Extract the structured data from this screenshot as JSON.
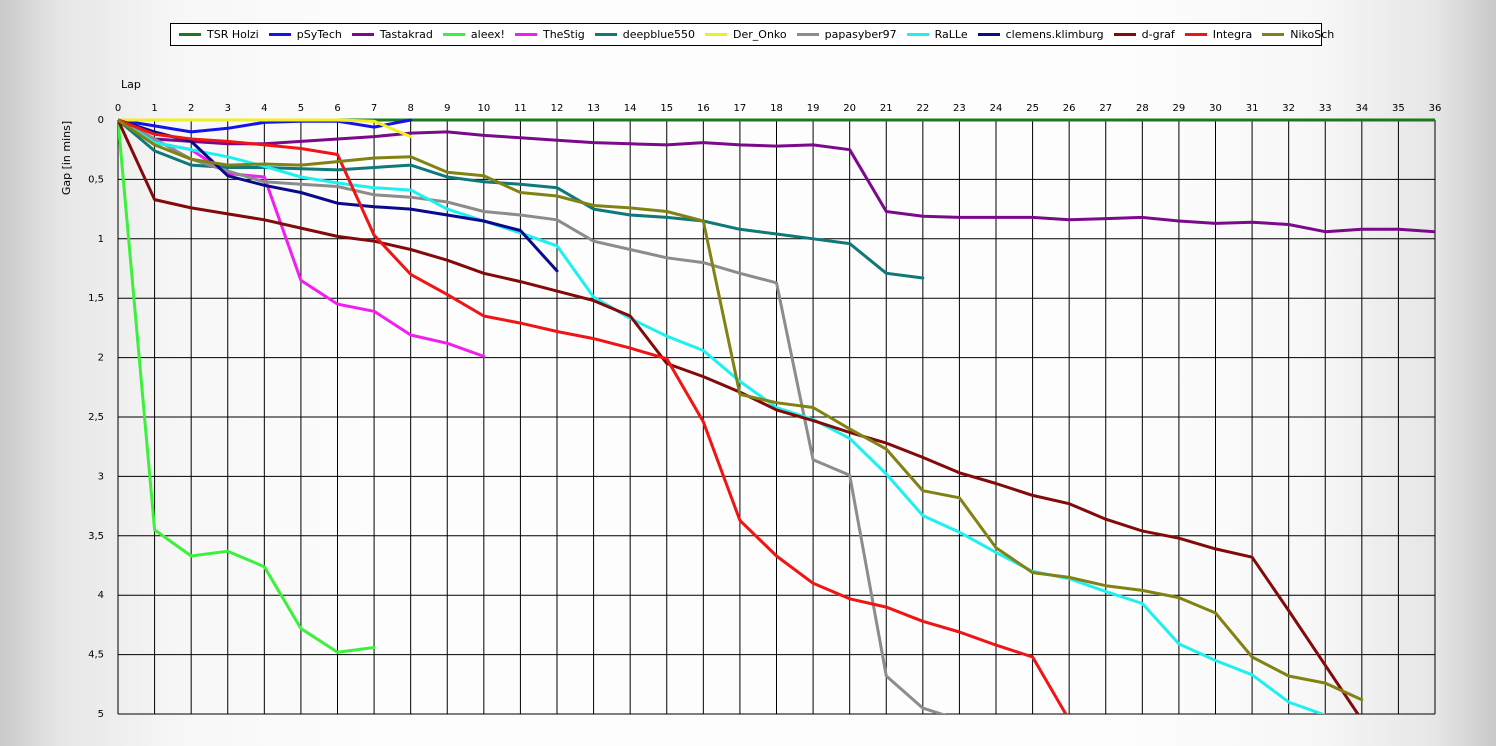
{
  "chart_data": {
    "type": "line",
    "title": "",
    "xlabel": "Lap",
    "ylabel": "Gap [in mins]",
    "xlim": [
      0,
      36
    ],
    "ylim": [
      0,
      5
    ],
    "y_inverted": true,
    "grid": true,
    "legend_position": "top",
    "x_ticks": [
      "0",
      "1",
      "2",
      "3",
      "4",
      "5",
      "6",
      "7",
      "8",
      "9",
      "10",
      "11",
      "12",
      "13",
      "14",
      "15",
      "16",
      "17",
      "18",
      "19",
      "20",
      "21",
      "22",
      "23",
      "24",
      "25",
      "26",
      "27",
      "28",
      "29",
      "30",
      "31",
      "32",
      "33",
      "34",
      "35",
      "36"
    ],
    "y_ticks": [
      {
        "value": 0,
        "label": "0"
      },
      {
        "value": 0.5,
        "label": "0,5"
      },
      {
        "value": 1,
        "label": "1"
      },
      {
        "value": 1.5,
        "label": "1,5"
      },
      {
        "value": 2,
        "label": "2"
      },
      {
        "value": 2.5,
        "label": "2,5"
      },
      {
        "value": 3,
        "label": "3"
      },
      {
        "value": 3.5,
        "label": "3,5"
      },
      {
        "value": 4,
        "label": "4"
      },
      {
        "value": 4.5,
        "label": "4,5"
      },
      {
        "value": 5,
        "label": "5"
      }
    ],
    "series": [
      {
        "name": "TSR Holzi",
        "color": "#1a7a1a",
        "x": [
          0,
          1,
          2,
          3,
          4,
          5,
          6,
          7,
          8,
          9,
          10,
          11,
          12,
          13,
          14,
          15,
          16,
          17,
          18,
          19,
          20,
          21,
          22,
          23,
          24,
          25,
          26,
          27,
          28,
          29,
          30,
          31,
          32,
          33,
          34,
          35,
          36
        ],
        "values": [
          0,
          0,
          0,
          0,
          0,
          0,
          0,
          0,
          0,
          0,
          0,
          0,
          0,
          0,
          0,
          0,
          0,
          0,
          0,
          0,
          0,
          0,
          0,
          0,
          0,
          0,
          0,
          0,
          0,
          0,
          0,
          0,
          0,
          0,
          0,
          0,
          0
        ]
      },
      {
        "name": "pSyTech",
        "color": "#1414e8",
        "x": [
          0,
          1,
          2,
          3,
          4,
          5,
          6,
          7,
          8
        ],
        "values": [
          0,
          0.05,
          0.1,
          0.07,
          0.02,
          0.01,
          0.01,
          0.06,
          0
        ]
      },
      {
        "name": "Tastakrad",
        "color": "#7a0a8a",
        "x": [
          0,
          1,
          2,
          3,
          4,
          5,
          6,
          7,
          8,
          9,
          10,
          11,
          12,
          13,
          14,
          15,
          16,
          17,
          18,
          19,
          20,
          21,
          22,
          23,
          24,
          25,
          26,
          27,
          28,
          29,
          30,
          31,
          32,
          33,
          34,
          35,
          36
        ],
        "values": [
          0,
          0.16,
          0.18,
          0.2,
          0.2,
          0.18,
          0.16,
          0.14,
          0.11,
          0.1,
          0.13,
          0.15,
          0.17,
          0.19,
          0.2,
          0.21,
          0.19,
          0.21,
          0.22,
          0.21,
          0.25,
          0.77,
          0.81,
          0.82,
          0.82,
          0.82,
          0.84,
          0.83,
          0.82,
          0.85,
          0.87,
          0.86,
          0.88,
          0.94,
          0.92,
          0.92,
          0.94
        ]
      },
      {
        "name": "aleex!",
        "color": "#3cf03c",
        "x": [
          0,
          1,
          2,
          3,
          4,
          5,
          6,
          7
        ],
        "values": [
          0,
          3.45,
          3.67,
          3.63,
          3.76,
          4.28,
          4.48,
          4.44
        ]
      },
      {
        "name": "TheStig",
        "color": "#f01ef0",
        "x": [
          0,
          1,
          2,
          3,
          4,
          5,
          6,
          7,
          8,
          9,
          10
        ],
        "values": [
          0,
          0.19,
          0.25,
          0.45,
          0.48,
          1.35,
          1.55,
          1.61,
          1.81,
          1.88,
          1.99
        ]
      },
      {
        "name": "deepblue550",
        "color": "#0f7878",
        "x": [
          0,
          1,
          2,
          3,
          4,
          5,
          6,
          7,
          8,
          9,
          10,
          11,
          12,
          13,
          14,
          15,
          16,
          17,
          18,
          19,
          20,
          21,
          22
        ],
        "values": [
          0,
          0.26,
          0.38,
          0.4,
          0.4,
          0.41,
          0.42,
          0.4,
          0.38,
          0.48,
          0.52,
          0.54,
          0.57,
          0.75,
          0.8,
          0.82,
          0.85,
          0.92,
          0.96,
          1.0,
          1.04,
          1.29,
          1.33
        ]
      },
      {
        "name": "Der_Onko",
        "color": "#f0f01e",
        "x": [
          0,
          1,
          2,
          3,
          4,
          5,
          6,
          7,
          8
        ],
        "values": [
          0,
          0,
          0,
          0,
          0,
          0,
          0,
          0.01,
          0.14
        ]
      },
      {
        "name": "papasyber97",
        "color": "#8c8c8c",
        "x": [
          0,
          1,
          2,
          3,
          4,
          5,
          6,
          7,
          8,
          9,
          10,
          11,
          12,
          13,
          14,
          15,
          16,
          17,
          18,
          19,
          20,
          21,
          22,
          23
        ],
        "values": [
          0,
          0.16,
          0.33,
          0.43,
          0.52,
          0.54,
          0.56,
          0.63,
          0.65,
          0.69,
          0.77,
          0.8,
          0.84,
          1.02,
          1.09,
          1.16,
          1.2,
          1.29,
          1.37,
          2.86,
          2.99,
          4.68,
          4.95,
          5.05
        ]
      },
      {
        "name": "RaLLe",
        "color": "#1ef0f0",
        "x": [
          0,
          1,
          2,
          3,
          4,
          5,
          6,
          7,
          8,
          9,
          10,
          11,
          12,
          13,
          14,
          15,
          16,
          17,
          18,
          19,
          20,
          21,
          22,
          23,
          24,
          25,
          26,
          27,
          28,
          29,
          30,
          31,
          32,
          33
        ],
        "values": [
          0,
          0.19,
          0.25,
          0.31,
          0.39,
          0.48,
          0.53,
          0.57,
          0.59,
          0.75,
          0.85,
          0.95,
          1.06,
          1.49,
          1.67,
          1.82,
          1.94,
          2.2,
          2.42,
          2.52,
          2.68,
          2.98,
          3.33,
          3.47,
          3.64,
          3.8,
          3.86,
          3.97,
          4.07,
          4.41,
          4.55,
          4.67,
          4.9,
          5.01
        ]
      },
      {
        "name": "clemens.klimburg",
        "color": "#0a0a8c",
        "x": [
          0,
          1,
          2,
          3,
          4,
          5,
          6,
          7,
          8,
          9,
          10,
          11,
          12
        ],
        "values": [
          0,
          0.1,
          0.18,
          0.47,
          0.55,
          0.61,
          0.7,
          0.73,
          0.75,
          0.8,
          0.85,
          0.93,
          1.27
        ]
      },
      {
        "name": "d-graf",
        "color": "#820a0a",
        "x": [
          0,
          1,
          2,
          3,
          4,
          5,
          6,
          7,
          8,
          9,
          10,
          11,
          12,
          13,
          14,
          15,
          16,
          17,
          18,
          19,
          20,
          21,
          22,
          23,
          24,
          25,
          26,
          27,
          28,
          29,
          30,
          31,
          32,
          33,
          34
        ],
        "values": [
          0,
          0.67,
          0.74,
          0.79,
          0.84,
          0.91,
          0.98,
          1.02,
          1.09,
          1.18,
          1.29,
          1.36,
          1.44,
          1.52,
          1.65,
          2.05,
          2.16,
          2.29,
          2.44,
          2.53,
          2.63,
          2.72,
          2.84,
          2.97,
          3.06,
          3.16,
          3.23,
          3.36,
          3.46,
          3.52,
          3.61,
          3.68,
          4.13,
          4.59,
          5.05
        ]
      },
      {
        "name": "Integra",
        "color": "#f01414",
        "x": [
          0,
          1,
          2,
          3,
          4,
          5,
          6,
          7,
          8,
          9,
          10,
          11,
          12,
          13,
          14,
          15,
          16,
          17,
          18,
          19,
          20,
          21,
          22,
          23,
          24,
          25,
          26
        ],
        "values": [
          0,
          0.12,
          0.16,
          0.18,
          0.21,
          0.24,
          0.29,
          0.97,
          1.3,
          1.47,
          1.65,
          1.71,
          1.78,
          1.84,
          1.92,
          2.01,
          2.54,
          3.37,
          3.67,
          3.9,
          4.03,
          4.1,
          4.22,
          4.31,
          4.42,
          4.52,
          5.05
        ]
      },
      {
        "name": "NikoSch",
        "color": "#828214",
        "x": [
          0,
          1,
          2,
          3,
          4,
          5,
          6,
          7,
          8,
          9,
          10,
          11,
          12,
          13,
          14,
          15,
          16,
          17,
          18,
          19,
          20,
          21,
          22,
          23,
          24,
          25,
          26,
          27,
          28,
          29,
          30,
          31,
          32,
          33,
          34
        ],
        "values": [
          0,
          0.21,
          0.33,
          0.38,
          0.37,
          0.38,
          0.35,
          0.32,
          0.31,
          0.44,
          0.47,
          0.61,
          0.64,
          0.72,
          0.74,
          0.77,
          0.85,
          2.31,
          2.38,
          2.42,
          2.6,
          2.77,
          3.12,
          3.18,
          3.6,
          3.81,
          3.85,
          3.92,
          3.96,
          4.02,
          4.15,
          4.52,
          4.68,
          4.74,
          4.88
        ]
      }
    ]
  }
}
